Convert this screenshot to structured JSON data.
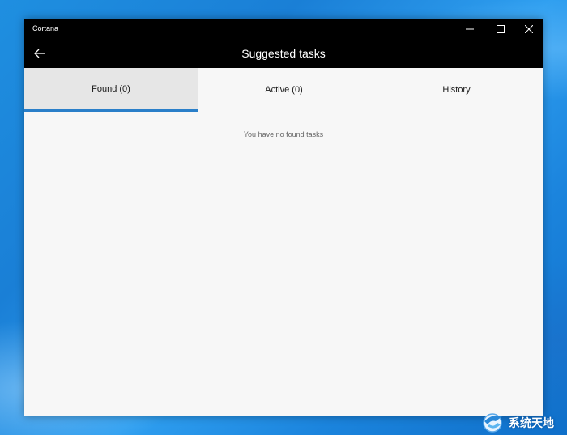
{
  "window": {
    "app_title": "Cortana",
    "controls": {
      "minimize_icon": "minimize-icon",
      "maximize_icon": "maximize-icon",
      "close_icon": "close-icon"
    }
  },
  "header": {
    "back_icon": "back-arrow-icon",
    "title": "Suggested tasks"
  },
  "tabs": [
    {
      "label": "Found (0)",
      "selected": true
    },
    {
      "label": "Active (0)",
      "selected": false
    },
    {
      "label": "History",
      "selected": false
    }
  ],
  "content": {
    "empty_message": "You have no found tasks"
  },
  "watermark": {
    "text": "系统天地"
  },
  "colors": {
    "titlebar": "#000000",
    "accent": "#2a7fc9",
    "selected_tab_bg": "#e6e6e6",
    "desktop": "#1a7fd6"
  }
}
